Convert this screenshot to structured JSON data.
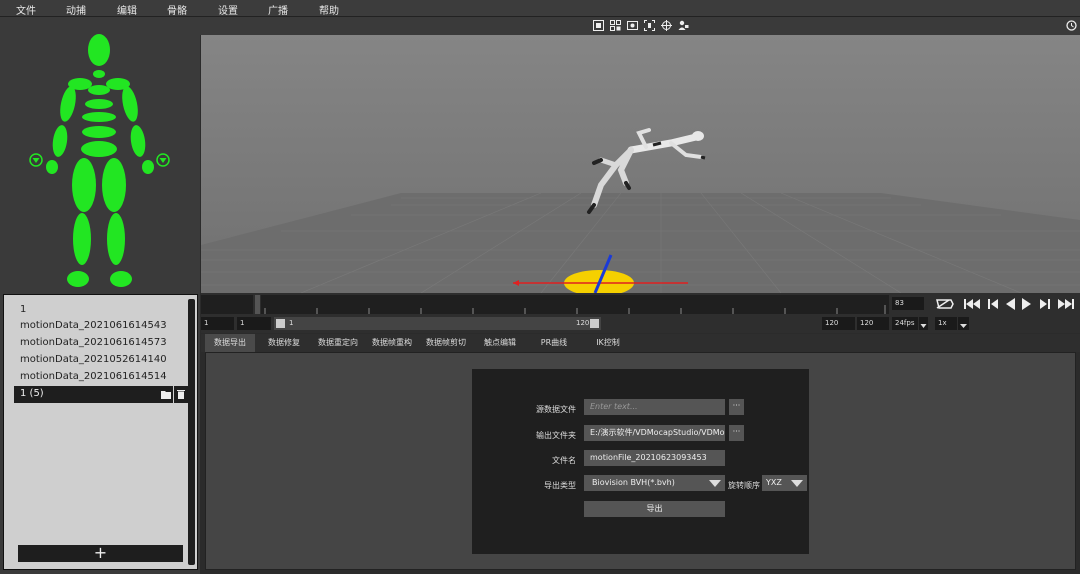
{
  "menu": [
    "文件",
    "动捕",
    "编辑",
    "骨骼",
    "设置",
    "广播",
    "帮助"
  ],
  "files": {
    "items": [
      "1",
      "motionData_2021061614543",
      "motionData_2021061614573",
      "motionData_2021052614140",
      "motionData_2021061614514"
    ],
    "selected": "1 (5)",
    "add_label": "+"
  },
  "viewport": {
    "toolbar_icons": [
      "grid-view-icon",
      "layout-icon",
      "camera-frame-icon",
      "fit-view-icon",
      "target-icon",
      "person-camera-icon"
    ],
    "accent_floor": "#f5d000"
  },
  "timeline": {
    "current_frame": "83",
    "start": "1",
    "start2": "1",
    "slider_start": "1",
    "slider_end": "120",
    "end": "120",
    "end2": "120",
    "fps": "24fps",
    "speed": "1x"
  },
  "tabs": [
    "数据导出",
    "数据修复",
    "数据重定向",
    "数据帧重构",
    "数据帧剪切",
    "触点编辑",
    "PR曲线",
    "IK控制"
  ],
  "export_form": {
    "source_label": "源数据文件",
    "source_placeholder": "Enter text...",
    "output_label": "输出文件夹",
    "output_value": "E:/演示软件/VDMocapStudio/VDMoc",
    "filename_label": "文件名",
    "filename_value": "motionFile_20210623093453",
    "type_label": "导出类型",
    "type_value": "Biovision BVH(*.bvh)",
    "rotation_label": "旋转顺序",
    "rotation_value": "YXZ",
    "export_button": "导出",
    "browse": "···"
  },
  "colors": {
    "skeleton_green": "#22e622",
    "axis_red": "#e02020",
    "axis_blue": "#1a3ad8"
  }
}
